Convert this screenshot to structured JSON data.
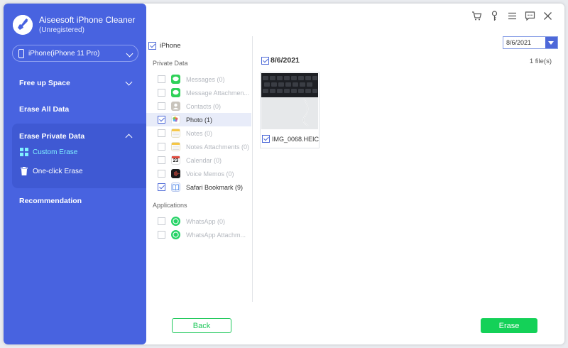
{
  "app": {
    "title": "Aiseesoft iPhone Cleaner",
    "subtitle": "(Unregistered)",
    "logo_icon": "broom-logo-icon"
  },
  "device": {
    "label": "iPhone(iPhone 11 Pro)"
  },
  "sidebar": {
    "free_up_space": "Free up Space",
    "erase_all_data": "Erase All Data",
    "erase_private_data": "Erase Private Data",
    "custom_erase": "Custom Erase",
    "one_click_erase": "One-click Erase",
    "recommendation": "Recommendation",
    "active_color": "#7ff0ff"
  },
  "top_icons": [
    "cart-icon",
    "key-icon",
    "menu-icon",
    "feedback-icon",
    "close-icon"
  ],
  "categories": {
    "root_label": "iPhone",
    "private_group": "Private Data",
    "applications_group": "Applications",
    "private_items": [
      {
        "label": "Messages (0)",
        "icon": "messages-icon",
        "checked": false
      },
      {
        "label": "Message Attachmen...",
        "icon": "message-attachments-icon",
        "checked": false
      },
      {
        "label": "Contacts (0)",
        "icon": "contacts-icon",
        "checked": false
      },
      {
        "label": "Photo (1)",
        "icon": "photos-icon",
        "checked": true
      },
      {
        "label": "Notes (0)",
        "icon": "notes-icon",
        "checked": false
      },
      {
        "label": "Notes Attachments (0)",
        "icon": "notes-attachments-icon",
        "checked": false
      },
      {
        "label": "Calendar (0)",
        "icon": "calendar-icon",
        "checked": false
      },
      {
        "label": "Voice Memos (0)",
        "icon": "voice-memos-icon",
        "checked": false
      },
      {
        "label": "Safari Bookmark (9)",
        "icon": "safari-bookmark-icon",
        "checked": true
      }
    ],
    "app_items": [
      {
        "label": "WhatsApp (0)",
        "icon": "whatsapp-icon",
        "checked": false
      },
      {
        "label": "WhatsApp Attachm...",
        "icon": "whatsapp-attachments-icon",
        "checked": false
      }
    ],
    "calendar_day": "23"
  },
  "content": {
    "date_filter": "8/6/2021",
    "date_header": "8/6/2021",
    "file_count": "1 file(s)",
    "files": [
      {
        "name": "IMG_0068.HEIC",
        "checked": true
      }
    ]
  },
  "buttons": {
    "back": "Back",
    "erase": "Erase"
  },
  "colors": {
    "sidebar_bg": "#4863e0",
    "accent": "#4f6bd8",
    "erase_green": "#14d158"
  }
}
